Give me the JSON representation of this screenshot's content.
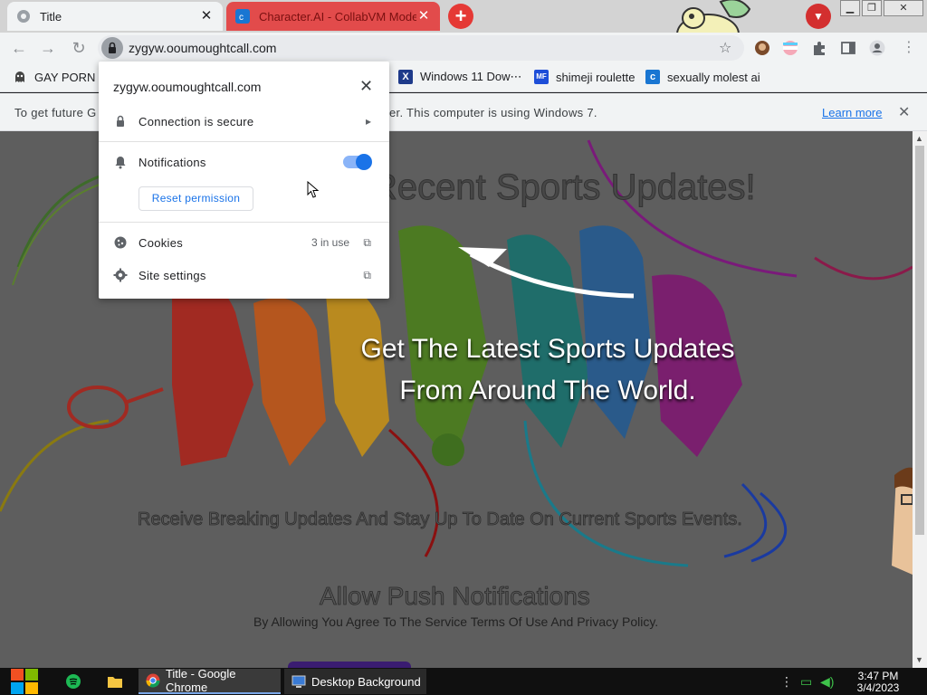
{
  "tabs": [
    {
      "title": "Title",
      "active": true
    },
    {
      "title": "Character.AI - CollabVM Mode",
      "active": false
    }
  ],
  "window_controls": {
    "minimize": "▁",
    "restore": "❐",
    "close": "✕"
  },
  "omnibox": {
    "url": "zygyw.ooumoughtcall.com"
  },
  "bookmarks": [
    {
      "label": "GAY PORN X",
      "icon": "ghost-icon"
    },
    {
      "label": "Windows 11 Dow⋯",
      "icon": "x-icon"
    },
    {
      "label": "shimeji roulette",
      "icon": "mf-icon"
    },
    {
      "label": "sexually molest ai",
      "icon": "character-ai-icon"
    }
  ],
  "infobar": {
    "text_left": "To get future G",
    "text_right": "er. This computer is using Windows 7.",
    "learn_more": "Learn more"
  },
  "popup": {
    "domain": "zygyw.ooumoughtcall.com",
    "connection": "Connection is secure",
    "notifications": "Notifications",
    "notifications_enabled": true,
    "reset_permission": "Reset permission",
    "cookies": "Cookies",
    "cookies_status": "3 in use",
    "site_settings": "Site settings"
  },
  "page": {
    "headline": "Recent Sports Updates!",
    "hero_line1": "Get The Latest Sports Updates",
    "hero_line2": "From Around The World.",
    "subline": "Receive Breaking Updates And Stay Up To Date On Current Sports Events.",
    "allow": "Allow Push Notifications",
    "terms": "By Allowing You Agree To The Service Terms Of Use And Privacy Policy."
  },
  "taskbar": {
    "items": [
      {
        "label": "Title - Google Chrome"
      },
      {
        "label": "Desktop Background"
      }
    ],
    "time": "3:47 PM",
    "date": "3/4/2023"
  },
  "colors": {
    "accent": "#1a73e8",
    "red_tab": "#e24b4b",
    "page_bg": "#5e5e5e"
  }
}
